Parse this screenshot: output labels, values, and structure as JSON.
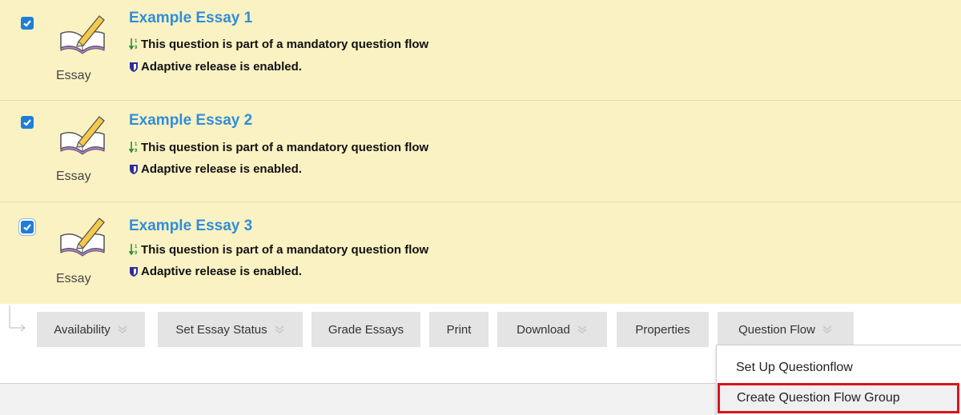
{
  "questions": [
    {
      "title": "Example Essay 1",
      "type": "Essay",
      "flow_note": "This question is part of a mandatory question flow",
      "release_note": "Adaptive release is enabled.",
      "checked": true
    },
    {
      "title": "Example Essay 2",
      "type": "Essay",
      "flow_note": "This question is part of a mandatory question flow",
      "release_note": "Adaptive release is enabled.",
      "checked": true
    },
    {
      "title": "Example Essay 3",
      "type": "Essay",
      "flow_note": "This question is part of a mandatory question flow",
      "release_note": "Adaptive release is enabled.",
      "checked": true
    }
  ],
  "toolbar": {
    "availability": "Availability",
    "set_essay_status": "Set Essay Status",
    "grade_essays": "Grade Essays",
    "print": "Print",
    "download": "Download",
    "properties": "Properties",
    "question_flow": "Question Flow"
  },
  "question_flow_menu": {
    "items": [
      "Set Up Questionflow",
      "Create Question Flow Group"
    ],
    "highlighted": "Create Question Flow Group"
  },
  "colors": {
    "item_background": "#fbf2c4",
    "title": "#2f8ed9",
    "checkbox": "#1f7ed8",
    "button_background": "#e4e4e4",
    "highlight_border": "#d9141e"
  },
  "icons": {
    "question_type": "essay-book-pencil-icon",
    "flow": "numbered-flow-icon",
    "release": "shield-icon",
    "dropdown": "chevron-down-icon"
  }
}
